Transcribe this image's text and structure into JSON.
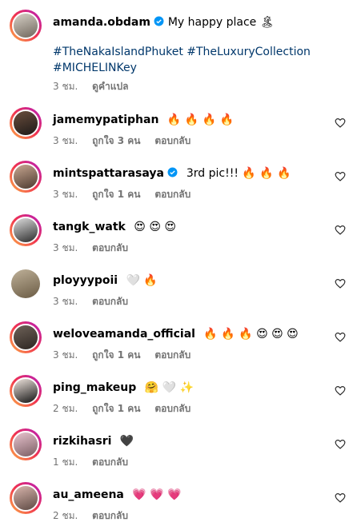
{
  "post": {
    "username": "amanda.obdam",
    "caption": "My happy place",
    "caption_emoji": "🏝",
    "hashtags": [
      "#TheNakaIslandPhuket",
      "#TheLuxuryCollection",
      "#MICHELINKey"
    ],
    "time": "3 ชม.",
    "translate": "ดูคำแปล"
  },
  "comments": [
    {
      "username": "jamemypatiphan",
      "text": "🔥 🔥 🔥 🔥",
      "time": "3 ชม.",
      "likes": "ถูกใจ 3 คน",
      "reply": "ตอบกลับ"
    },
    {
      "username": "mintspattarasaya",
      "text": "3rd pic!!! 🔥 🔥 🔥",
      "time": "3 ชม.",
      "likes": "ถูกใจ 1 คน",
      "reply": "ตอบกลับ"
    },
    {
      "username": "tangk_watk",
      "text": "😍 😍 😍",
      "time": "3 ชม.",
      "likes": "",
      "reply": "ตอบกลับ"
    },
    {
      "username": "ployyypoii",
      "text": "🤍 🔥",
      "time": "3 ชม.",
      "likes": "",
      "reply": "ตอบกลับ"
    },
    {
      "username": "weloveamanda_official",
      "text": "🔥 🔥 🔥 😍 😍 😍",
      "time": "3 ชม.",
      "likes": "ถูกใจ 1 คน",
      "reply": "ตอบกลับ"
    },
    {
      "username": "ping_makeup",
      "text": "🤗 🤍 ✨",
      "time": "2 ชม.",
      "likes": "ถูกใจ 1 คน",
      "reply": "ตอบกลับ"
    },
    {
      "username": "rizkihasri",
      "text": "🖤",
      "time": "1 ชม.",
      "likes": "",
      "reply": "ตอบกลับ"
    },
    {
      "username": "au_ameena",
      "text": "💗 💗 💗",
      "time": "2 ชม.",
      "likes": "",
      "reply": "ตอบกลับ"
    }
  ],
  "colors": {
    "link": "#00376b",
    "meta": "#737373",
    "verified": "#0095f6"
  }
}
